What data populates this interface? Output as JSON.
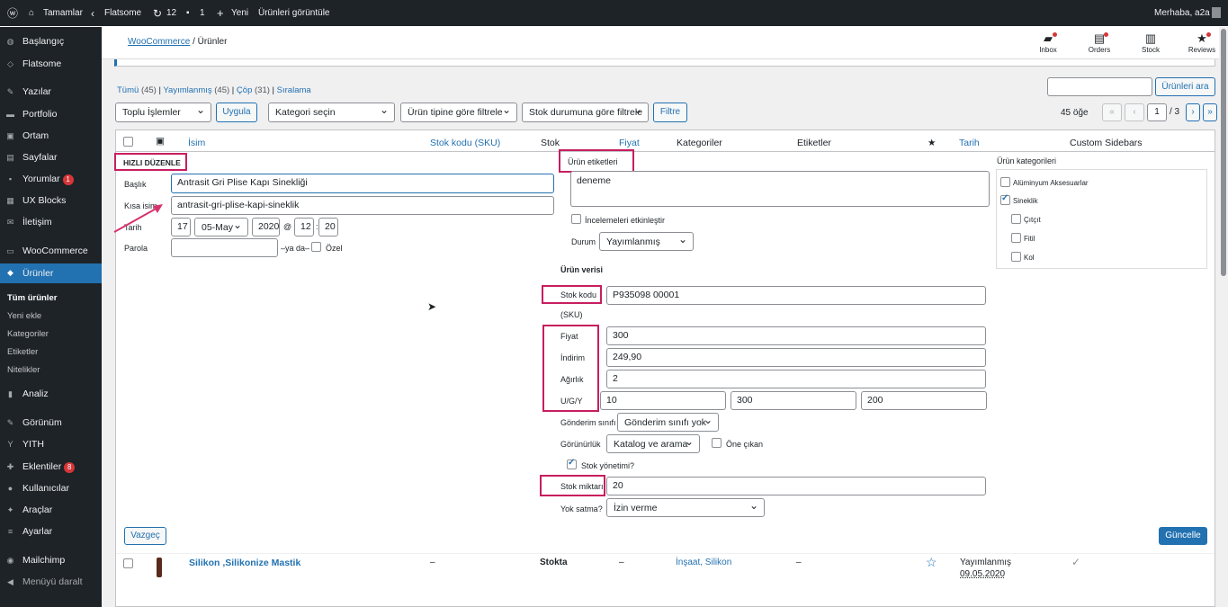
{
  "adminbar": {
    "site": "Tamamlar",
    "theme": "Flatsome",
    "updates": "12",
    "comments": "1",
    "new": "Yeni",
    "view": "Ürünleri görüntüle",
    "greeting": "Merhaba, a2a"
  },
  "menu": {
    "dashboard": "Başlangıç",
    "flatsome": "Flatsome",
    "posts": "Yazılar",
    "portfolio": "Portfolio",
    "media": "Ortam",
    "pages": "Sayfalar",
    "comments": "Yorumlar",
    "comments_badge": "1",
    "uxblocks": "UX Blocks",
    "contact": "İletişim",
    "woocommerce": "WooCommerce",
    "products": "Ürünler",
    "sub_all": "Tüm ürünler",
    "sub_new": "Yeni ekle",
    "sub_cats": "Kategoriler",
    "sub_tags": "Etiketler",
    "sub_attrs": "Nitelikler",
    "analytics": "Analiz",
    "appearance": "Görünüm",
    "yith": "YITH",
    "plugins": "Eklentiler",
    "plugins_badge": "8",
    "users": "Kullanıcılar",
    "tools": "Araçlar",
    "settings": "Ayarlar",
    "mailchimp": "Mailchimp",
    "collapse": "Menüyü daralt"
  },
  "header": {
    "crumb_link": "WooCommerce",
    "crumb_sep": "/",
    "crumb_current": "Ürünler",
    "inbox": "Inbox",
    "orders": "Orders",
    "stock": "Stock",
    "reviews": "Reviews"
  },
  "filters": {
    "all": "Tümü",
    "all_count": "(45)",
    "published": "Yayımlanmış",
    "published_count": "(45)",
    "trash": "Çöp",
    "trash_count": "(31)",
    "sorting": "Sıralama",
    "search_btn": "Ürünleri ara",
    "bulk": "Toplu İşlemler",
    "apply": "Uygula",
    "category": "Kategori seçin",
    "type": "Ürün tipine göre filtrele",
    "stock": "Stok durumuna göre filtrele",
    "filter": "Filtre",
    "count": "45 öğe",
    "page": "1",
    "of": "/ 3"
  },
  "columns": {
    "name": "İsim",
    "sku": "Stok kodu (SKU)",
    "stock": "Stok",
    "price": "Fiyat",
    "cats": "Kategoriler",
    "tags": "Etiketler",
    "date": "Tarih",
    "sidebars": "Custom Sidebars"
  },
  "quickedit": {
    "title": "HIZLI DÜZENLE",
    "title_label": "Başlık",
    "title_value": "Antrasit Gri Plise Kapı Sinekliği",
    "slug_label": "Kısa isim",
    "slug_value": "antrasit-gri-plise-kapi-sineklik",
    "date_label": "Tarih",
    "day": "17",
    "month": "05-May",
    "year": "2020",
    "at": "@",
    "hour": "12",
    "minute": "20",
    "password_label": "Parola",
    "password_or": "–ya da–",
    "private": "Özel",
    "tags_label": "Ürün etiketleri",
    "tags_value": "deneme",
    "enable_reviews": "İncelemeleri etkinleştir",
    "status_label": "Durum",
    "status_value": "Yayımlanmış",
    "product_data": "Ürün verisi",
    "sku_label": "Stok kodu",
    "sku_sub": "(SKU)",
    "sku_value": "P935098 00001",
    "price_label": "Fiyat",
    "price_value": "300",
    "sale_label": "İndirim",
    "sale_value": "249,90",
    "weight_label": "Ağırlık",
    "weight_value": "2",
    "dims_label": "U/G/Y",
    "length": "10",
    "width": "300",
    "height": "200",
    "shipping_label": "Gönderim sınıfı",
    "shipping_value": "Gönderim sınıfı yok",
    "visibility_label": "Görünürlük",
    "visibility_value": "Katalog ve arama",
    "featured": "Öne çıkan",
    "manage_stock": "Stok yönetimi?",
    "stock_qty_label": "Stok miktarı",
    "stock_qty_value": "20",
    "backorders_label": "Yok satma?",
    "backorders_value": "İzin verme",
    "cats_label": "Ürün kategorileri",
    "cat1": "Alüminyum Aksesuarlar",
    "cat2": "Sineklik",
    "cat3": "Çıtçıt",
    "cat4": "Fitil",
    "cat5": "Kol",
    "cancel": "Vazgeç",
    "update": "Güncelle"
  },
  "row": {
    "name": "Silikon ,Silikonize Mastik",
    "sku": "–",
    "stock": "Stokta",
    "price": "–",
    "cats": "İnşaat, Silikon",
    "tags": "–",
    "status": "Yayımlanmış",
    "date": "09.05.2020"
  }
}
